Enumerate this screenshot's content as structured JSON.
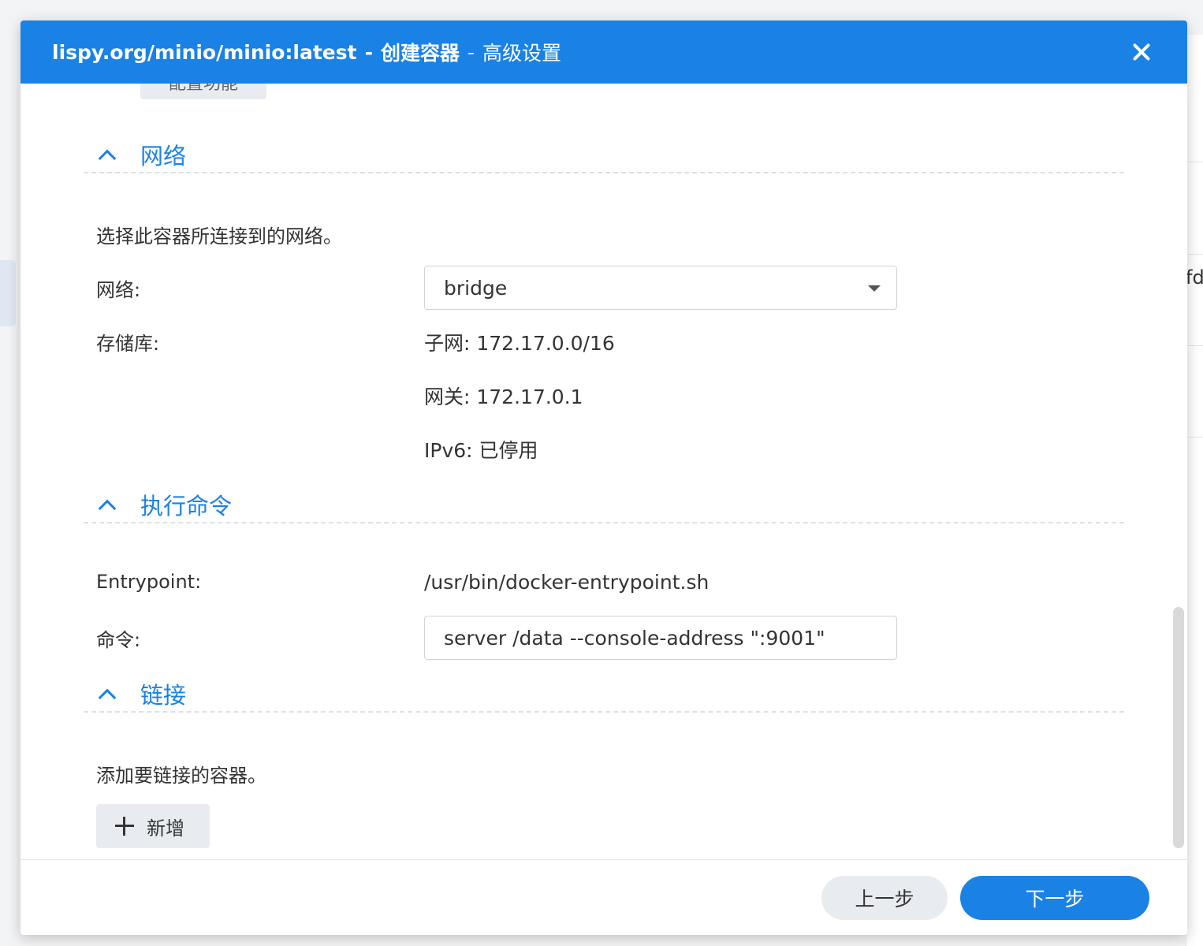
{
  "window": {
    "title_image": "lispy.org/minio/minio:latest",
    "title_sep": "-",
    "title_action": "创建容器",
    "title_sep2": "-",
    "title_page": "高级设置"
  },
  "cut_button_label": "配置功能",
  "network": {
    "header": "网络",
    "description": "选择此容器所连接到的网络。",
    "network_label": "网络:",
    "network_value": "bridge",
    "storage_label": "存储库:",
    "subnet": "子网: 172.17.0.0/16",
    "gateway": "网关: 172.17.0.1",
    "ipv6": "IPv6: 已停用"
  },
  "command": {
    "header": "执行命令",
    "entrypoint_label": "Entrypoint:",
    "entrypoint_value": "/usr/bin/docker-entrypoint.sh",
    "command_label": "命令:",
    "command_value": "server /data --console-address \":9001\""
  },
  "links": {
    "header": "链接",
    "description": "添加要链接的容器。",
    "add_label": "新增"
  },
  "footer": {
    "prev_label": "上一步",
    "next_label": "下一步"
  },
  "background": {
    "right_text": "fd"
  },
  "colors": {
    "accent": "#1a82e5"
  }
}
